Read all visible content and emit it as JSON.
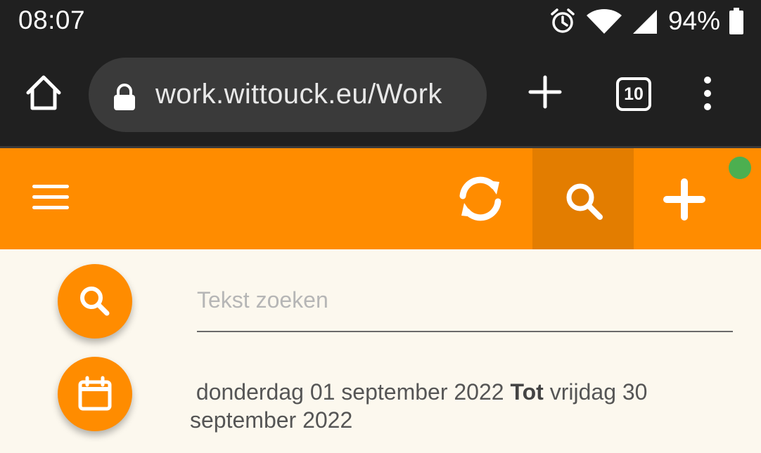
{
  "status_bar": {
    "time": "08:07",
    "battery": "94%",
    "icons": [
      "alarm-icon",
      "wifi-icon",
      "signal-icon",
      "battery-icon"
    ]
  },
  "browser": {
    "url": "work.wittouck.eu/Work",
    "tab_count": "10",
    "icons": [
      "home-icon",
      "lock-icon",
      "plus-icon",
      "more-vert-icon"
    ]
  },
  "app_bar": {
    "icons": [
      "hamburger-icon",
      "sync-icon",
      "search-icon",
      "plus-icon"
    ],
    "online_indicator_color": "#4caf50"
  },
  "search": {
    "placeholder": "Tekst zoeken",
    "value": ""
  },
  "date_range": {
    "from": "donderdag 01 september 2022",
    "separator": "Tot",
    "to": "vrijdag 30 september 2022"
  },
  "colors": {
    "accent": "#ff8c00",
    "accent_dark": "#e37d00",
    "background": "#fcf8ee",
    "status_bar": "#202020"
  }
}
